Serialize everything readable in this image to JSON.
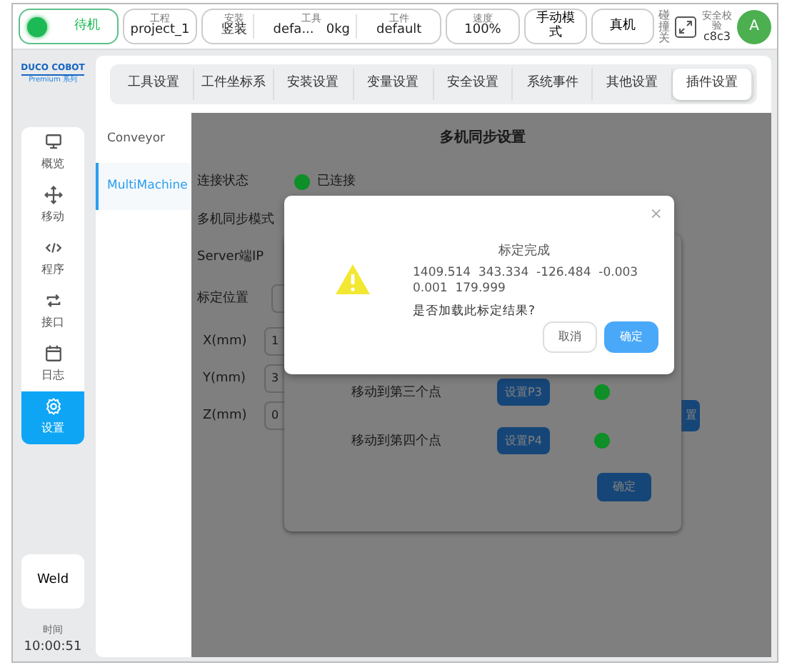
{
  "status_bar": {
    "state": {
      "label": "待机",
      "color": "#1db954"
    },
    "items": [
      {
        "kind": "single",
        "label": "工程",
        "value": "project_1"
      },
      {
        "kind": "group",
        "parts": [
          {
            "label": "安装",
            "value": "竖装"
          },
          {
            "label": "工具",
            "value": "defa...   0kg"
          },
          {
            "label": "工件",
            "value": "default"
          }
        ]
      },
      {
        "kind": "single",
        "label": "速度",
        "value": "100%"
      },
      {
        "kind": "button",
        "value": "手动模式"
      },
      {
        "kind": "button",
        "value": "真机"
      }
    ],
    "collision": "碰撞关",
    "safety": {
      "label": "安全校验",
      "value": "c8c3"
    },
    "avatar": "A"
  },
  "logo": {
    "brand": "DUCO COBOT",
    "series": "Premium 系列"
  },
  "sidebar": {
    "items": [
      {
        "label": "概览",
        "selected": false
      },
      {
        "label": "移动",
        "selected": false
      },
      {
        "label": "程序",
        "selected": false
      },
      {
        "label": "接口",
        "selected": false
      },
      {
        "label": "日志",
        "selected": false
      },
      {
        "label": "设置",
        "selected": true
      }
    ],
    "plugin_button": "Weld",
    "time_label": "时间",
    "time": "10:00:51"
  },
  "tabs": [
    {
      "label": "工具设置",
      "selected": false
    },
    {
      "label": "工件坐标系",
      "selected": false
    },
    {
      "label": "安装设置",
      "selected": false
    },
    {
      "label": "变量设置",
      "selected": false
    },
    {
      "label": "安全设置",
      "selected": false
    },
    {
      "label": "系统事件",
      "selected": false
    },
    {
      "label": "其他设置",
      "selected": false
    },
    {
      "label": "插件设置",
      "selected": true
    }
  ],
  "plugins": [
    {
      "label": "Conveyor",
      "selected": false
    },
    {
      "label": "MultiMachine",
      "selected": true
    }
  ],
  "panel": {
    "title": "多机同步设置",
    "connection": {
      "label": "连接状态",
      "value": "已连接",
      "color": "#0e8f27"
    },
    "labels": [
      "多机同步模式",
      "Server端IP"
    ],
    "position": {
      "label": "标定位置"
    },
    "coords": [
      {
        "label": "X(mm)",
        "value": "1"
      },
      {
        "label": "Y(mm)",
        "value": "3"
      },
      {
        "label": "Z(mm)",
        "value": "0"
      }
    ],
    "side_button": "置"
  },
  "calibration_dialog": {
    "points": [
      {
        "label": "移动到第三个点",
        "button": "设置P3",
        "color": "#0e8f27"
      },
      {
        "label": "移动到第四个点",
        "button": "设置P4",
        "color": "#0e8f27"
      }
    ],
    "confirm": "确定"
  },
  "modal": {
    "close": "×",
    "title": "标定完成",
    "values": [
      "1409.514  343.334  -126.484  -0.003",
      "0.001  179.999"
    ],
    "question": "是否加载此标定结果?",
    "buttons": [
      {
        "kind": "secondary",
        "label": "取消"
      },
      {
        "kind": "primary",
        "label": "确定"
      }
    ]
  }
}
